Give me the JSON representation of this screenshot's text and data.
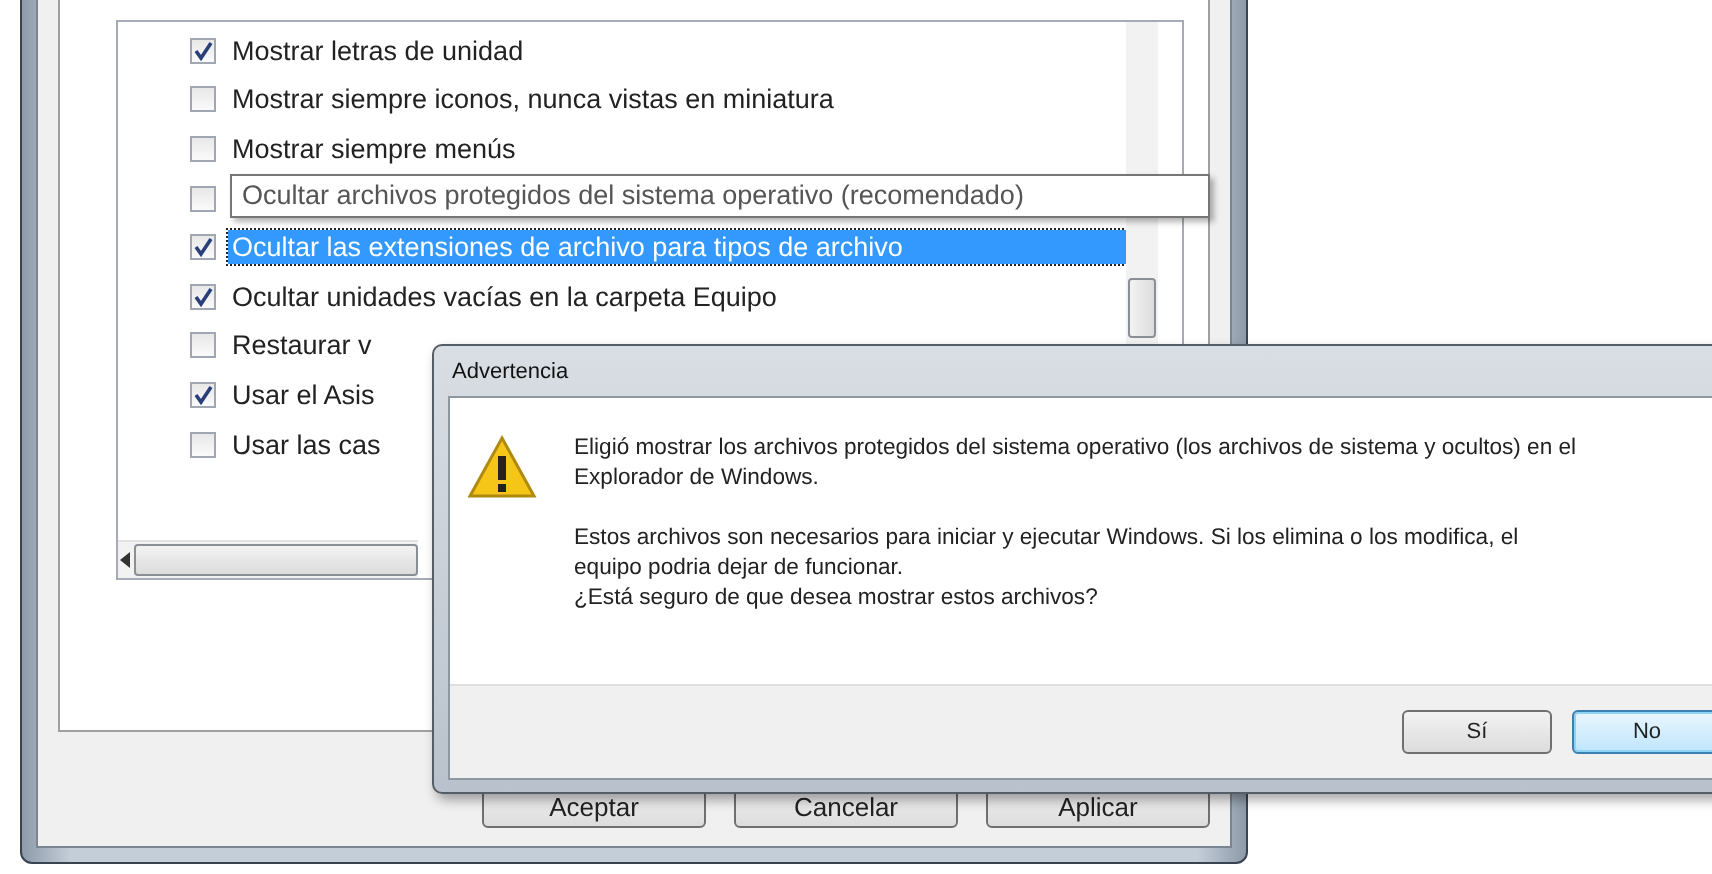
{
  "options_window": {
    "rows": [
      {
        "label": "Mostrar letras de unidad",
        "checked": true,
        "selected": false
      },
      {
        "label": "Mostrar siempre iconos, nunca vistas en miniatura",
        "checked": false,
        "selected": false
      },
      {
        "label": "Mostrar siempre menús",
        "checked": false,
        "selected": false
      },
      {
        "checked": false,
        "selected": false
      },
      {
        "label": "Ocultar las extensiones de archivo para tipos de archivo",
        "checked": true,
        "selected": true
      },
      {
        "label": "Ocultar unidades vacías en la carpeta Equipo",
        "checked": true,
        "selected": false
      },
      {
        "label": "Restaurar v",
        "checked": false,
        "selected": false
      },
      {
        "label": "Usar el Asis",
        "checked": true,
        "selected": false
      },
      {
        "label": "Usar las cas",
        "checked": false,
        "selected": false
      }
    ],
    "tooltip": "Ocultar archivos protegidos del sistema operativo (recomendado)",
    "buttons": [
      "Aceptar",
      "Cancelar",
      "Aplicar"
    ]
  },
  "dialog": {
    "title": "Advertencia",
    "paragraphs": [
      "Eligió mostrar los archivos protegidos del sistema operativo (los archivos de sistema y ocultos) en el Explorador de Windows.",
      "Estos archivos son necesarios para iniciar y ejecutar Windows. Si los elimina o los modifica, el equipo podria dejar de funcionar.",
      "¿Está seguro de que desea mostrar estos archivos?"
    ],
    "buttons": [
      {
        "label": "Sí",
        "default": false
      },
      {
        "label": "No",
        "default": true
      }
    ]
  }
}
